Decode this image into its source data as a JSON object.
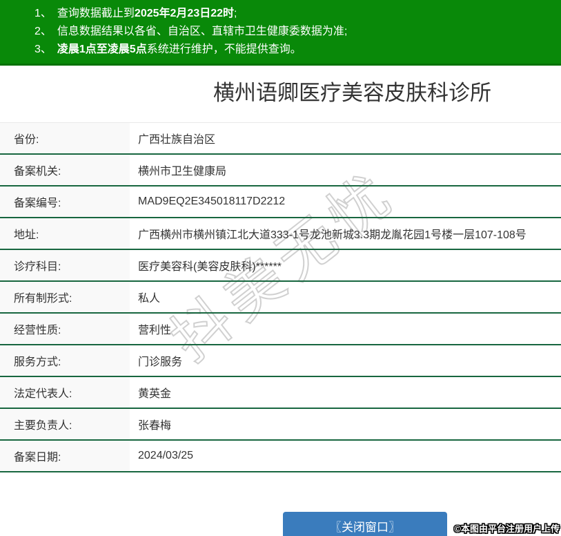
{
  "colors": {
    "header-green": "#098909",
    "header-green-border": "#067206",
    "separator-green": "#17663f",
    "label-bg": "#f9f9f9",
    "button-blue": "#3a7cbd",
    "text-dark": "#333333",
    "watermark-gray": "#cccccc"
  },
  "notices": {
    "items": [
      {
        "num": "1、",
        "pre": "查询数据截止到",
        "bold": "2025年2月23日22时",
        "post": ";"
      },
      {
        "num": "2、",
        "pre": "信息数据结果以各省、自治区、直辖市卫生健康委数据为准;",
        "bold": "",
        "post": ""
      },
      {
        "num": "3、",
        "pre": "",
        "bold": "凌晨1点至凌晨5点",
        "post": "系统进行维护，不能提供查询。"
      }
    ]
  },
  "title": "横州语卿医疗美容皮肤科诊所",
  "table": {
    "rows": [
      {
        "label": "省份:",
        "value": "广西壮族自治区"
      },
      {
        "label": "备案机关:",
        "value": "横州市卫生健康局"
      },
      {
        "label": "备案编号:",
        "value": "MAD9EQ2E345018117D2212"
      },
      {
        "label": "地址:",
        "value": "广西横州市横州镇江北大道333-1号龙池新城3.3期龙胤花园1号楼一层107-108号"
      },
      {
        "label": "诊疗科目:",
        "value": "医疗美容科(美容皮肤科)******"
      },
      {
        "label": "所有制形式:",
        "value": "私人"
      },
      {
        "label": "经营性质:",
        "value": "营利性"
      },
      {
        "label": "服务方式:",
        "value": "门诊服务"
      },
      {
        "label": "法定代表人:",
        "value": "黄英金"
      },
      {
        "label": "主要负责人:",
        "value": "张春梅"
      },
      {
        "label": "备案日期:",
        "value": "2024/03/25"
      }
    ]
  },
  "watermark": "抖美无忧",
  "close_button": {
    "label": "〖关闭窗口〗"
  },
  "caption": "©本图由平台注册用户上传"
}
